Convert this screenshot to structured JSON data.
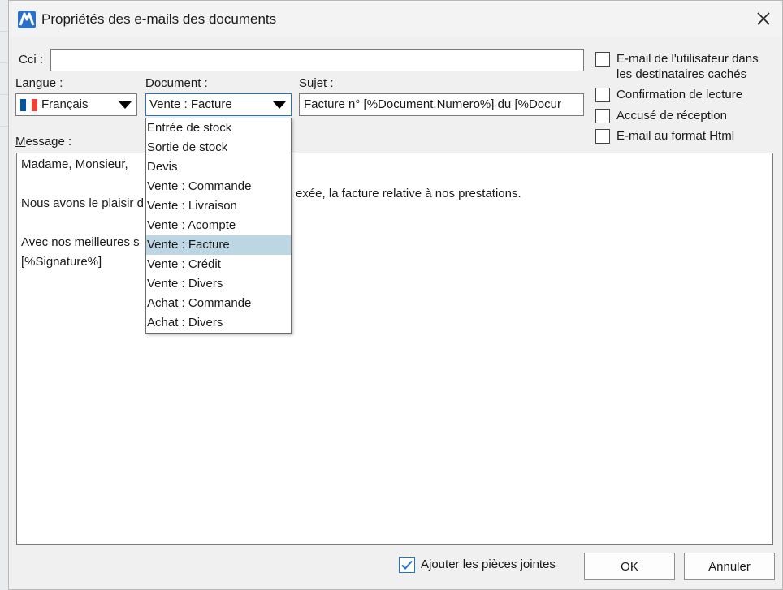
{
  "window": {
    "title": "Propriétés des e-mails des documents"
  },
  "fields": {
    "cci_label": "Cci :",
    "cci_value": "",
    "langue_label": "Langue :",
    "langue_value": "Français",
    "document_label": "Document :",
    "document_value": "Vente : Facture",
    "sujet_label": "Sujet :",
    "sujet_value": "Facture n° [%Document.Numero%] du [%Docur",
    "message_label": "Message :"
  },
  "options": {
    "hidden_recipient": {
      "label_line1": "E-mail de l'utilisateur dans",
      "label_line2": "les destinataires cachés",
      "checked": false
    },
    "read_confirmation": {
      "label": "Confirmation de lecture",
      "checked": false
    },
    "delivery_receipt": {
      "label": "Accusé de réception",
      "checked": false
    },
    "html_format": {
      "label": "E-mail au format Html",
      "checked": false
    }
  },
  "message": {
    "lines": [
      "Madame, Monsieur,",
      "",
      "Nous avons le plaisir d",
      "",
      "Avec nos meilleures s",
      "[%Signature%]"
    ],
    "line3_tail": "exée, la facture relative à nos prestations."
  },
  "document_dropdown": {
    "items": [
      "Entrée de stock",
      "Sortie de stock",
      "Devis",
      "Vente : Commande",
      "Vente : Livraison",
      "Vente : Acompte",
      "Vente : Facture",
      "Vente : Crédit",
      "Vente : Divers",
      "Achat : Commande",
      "Achat : Divers"
    ],
    "selected_index": 6
  },
  "footer": {
    "attach_label": "Ajouter les pièces jointes",
    "attach_checked": true,
    "ok_label": "OK",
    "cancel_label": "Annuler"
  },
  "colors": {
    "accent": "#1f74c9",
    "selection": "#bcd6e4",
    "flag_blue": "#0055a4",
    "flag_white": "#ffffff",
    "flag_red": "#ef4135"
  },
  "icons": {
    "app": "app-logo-icon",
    "close": "close-icon",
    "dropdown": "chevron-down-icon",
    "language_flag": "france-flag-icon",
    "check": "checkmark-icon"
  }
}
